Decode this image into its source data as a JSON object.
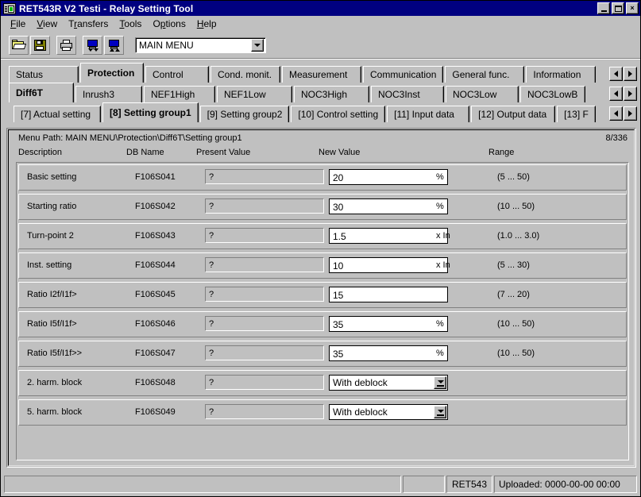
{
  "window": {
    "title": "RET543R V2 Testi - Relay Setting Tool",
    "icon": "relay-device-icon",
    "minimize_label": "Minimize",
    "maximize_label": "Maximize",
    "close_label": "×"
  },
  "menubar": {
    "items": [
      {
        "label": "File",
        "accel": "F"
      },
      {
        "label": "View",
        "accel": "V"
      },
      {
        "label": "Transfers",
        "accel": "r"
      },
      {
        "label": "Tools",
        "accel": "T"
      },
      {
        "label": "Options",
        "accel": "p"
      },
      {
        "label": "Help",
        "accel": "H"
      }
    ]
  },
  "toolbar": {
    "buttons": [
      {
        "name": "open-icon",
        "title": "Open"
      },
      {
        "name": "save-icon",
        "title": "Save"
      },
      {
        "name": "print-icon",
        "title": "Print"
      },
      {
        "name": "download-to-relay-icon",
        "title": "Download"
      },
      {
        "name": "upload-from-relay-icon",
        "title": "Upload"
      }
    ],
    "menu_combo": {
      "value": "MAIN MENU",
      "arrow": "chevron-down-icon"
    }
  },
  "tab_rows": [
    {
      "name": "function-group-tabs",
      "tabs": [
        {
          "label": "Status",
          "active": false
        },
        {
          "label": "Protection",
          "active": true
        },
        {
          "label": "Control",
          "active": false
        },
        {
          "label": "Cond. monit.",
          "active": false
        },
        {
          "label": "Measurement",
          "active": false
        },
        {
          "label": "Communication",
          "active": false
        },
        {
          "label": "General func.",
          "active": false
        },
        {
          "label": "Information",
          "active": false
        }
      ]
    },
    {
      "name": "function-block-tabs",
      "tabs": [
        {
          "label": "Diff6T",
          "active": true
        },
        {
          "label": "Inrush3",
          "active": false
        },
        {
          "label": "NEF1High",
          "active": false
        },
        {
          "label": "NEF1Low",
          "active": false
        },
        {
          "label": "NOC3High",
          "active": false
        },
        {
          "label": "NOC3Inst",
          "active": false
        },
        {
          "label": "NOC3Low",
          "active": false
        },
        {
          "label": "NOC3LowB",
          "active": false
        }
      ]
    },
    {
      "name": "parameter-page-tabs",
      "tabs": [
        {
          "label": "[7] Actual setting",
          "active": false
        },
        {
          "label": "[8] Setting group1",
          "active": true
        },
        {
          "label": "[9] Setting group2",
          "active": false
        },
        {
          "label": "[10] Control setting",
          "active": false
        },
        {
          "label": "[11] Input data",
          "active": false
        },
        {
          "label": "[12] Output data",
          "active": false
        },
        {
          "label": "[13] F",
          "active": false
        }
      ]
    }
  ],
  "tab_scroll": {
    "left_icon": "arrow-left-icon",
    "right_icon": "arrow-right-icon"
  },
  "content": {
    "menu_path_label": "Menu Path:",
    "menu_path": "MAIN MENU\\Protection\\Diff6T\\Setting group1",
    "menu_path_full": "Menu Path:  MAIN MENU\\Protection\\Diff6T\\Setting group1",
    "counter": "8/336",
    "columns": {
      "description": "Description",
      "db_name": "DB Name",
      "present_value": "Present Value",
      "new_value": "New Value",
      "range": "Range"
    },
    "rows": [
      {
        "description": "Basic setting",
        "db_name": "F106S041",
        "present_value": "?",
        "new_value": "20",
        "type": "text",
        "unit": "%",
        "range": "(5 ... 50)"
      },
      {
        "description": "Starting ratio",
        "db_name": "F106S042",
        "present_value": "?",
        "new_value": "30",
        "type": "text",
        "unit": "%",
        "range": "(10 ... 50)"
      },
      {
        "description": "Turn-point 2",
        "db_name": "F106S043",
        "present_value": "?",
        "new_value": "1.5",
        "type": "text",
        "unit": "x In",
        "range": "(1.0 ... 3.0)"
      },
      {
        "description": "Inst. setting",
        "db_name": "F106S044",
        "present_value": "?",
        "new_value": "10",
        "type": "text",
        "unit": "x In",
        "range": "(5 ... 30)"
      },
      {
        "description": "Ratio I2f/I1f>",
        "db_name": "F106S045",
        "present_value": "?",
        "new_value": "15",
        "type": "text",
        "unit": "",
        "range": "(7 ... 20)"
      },
      {
        "description": "Ratio I5f/I1f>",
        "db_name": "F106S046",
        "present_value": "?",
        "new_value": "35",
        "type": "text",
        "unit": "%",
        "range": "(10 ... 50)"
      },
      {
        "description": "Ratio I5f/I1f>>",
        "db_name": "F106S047",
        "present_value": "?",
        "new_value": "35",
        "type": "text",
        "unit": "%",
        "range": "(10 ... 50)"
      },
      {
        "description": "2. harm. block",
        "db_name": "F106S048",
        "present_value": "?",
        "new_value": "With deblock",
        "type": "select",
        "unit": "",
        "range": ""
      },
      {
        "description": "5. harm. block",
        "db_name": "F106S049",
        "present_value": "?",
        "new_value": "With deblock",
        "type": "select",
        "unit": "",
        "range": ""
      }
    ]
  },
  "statusbar": {
    "message": "",
    "small_pane": "",
    "device": "RET543",
    "uploaded": "Uploaded: 0000-00-00 00:00"
  },
  "colors": {
    "titlebar": "#000080",
    "face": "#c0c0c0",
    "field": "#ffffff",
    "shadow": "#808080",
    "highlight": "#ffffff"
  }
}
